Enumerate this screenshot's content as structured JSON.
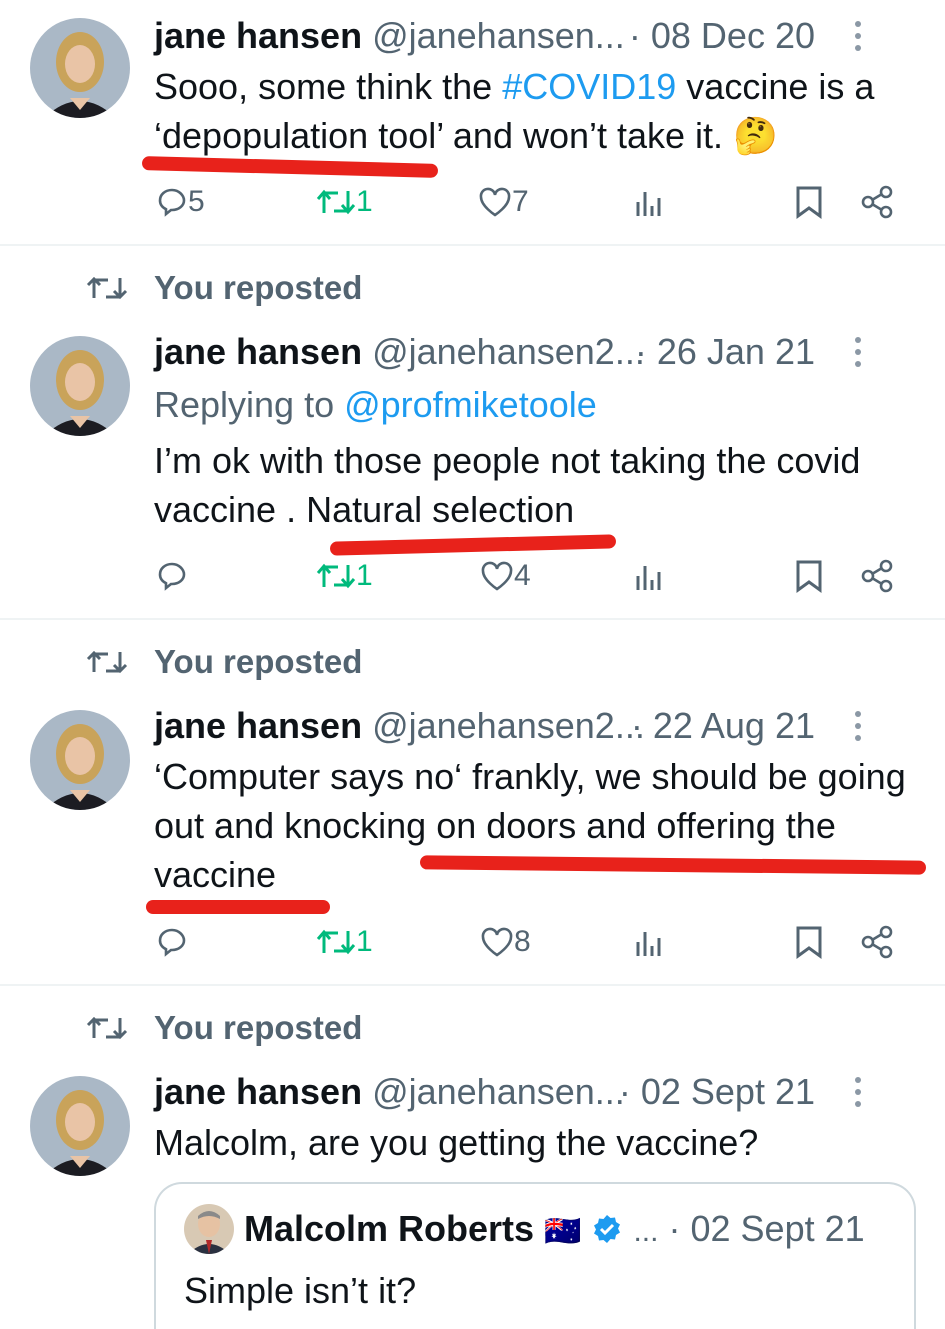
{
  "tweets": [
    {
      "reposted": false,
      "name": "jane hansen",
      "handle": "@janehansen...",
      "date": "· 08 Dec 20",
      "text_pre": "Sooo, some think the ",
      "hashtag": "#COVID19",
      "text_post": " vaccine is a ‘depopulation tool’ and won’t take it. 🤔",
      "replies": "5",
      "reposts": "1",
      "likes": "7"
    },
    {
      "reposted": true,
      "repost_label": "You reposted",
      "name": "jane hansen",
      "handle": "@janehansen2...",
      "date": "· 26 Jan 21",
      "replying_label": "Replying to ",
      "replying_to": "@profmiketoole",
      "text": "I’m ok with those people not taking the covid vaccine . Natural selection",
      "replies": "",
      "reposts": "1",
      "likes": "4"
    },
    {
      "reposted": true,
      "repost_label": "You reposted",
      "name": "jane hansen",
      "handle": "@janehansen2...",
      "date": "· 22 Aug 21",
      "text": "‘Computer says no‘  frankly, we should be going out and knocking on doors and offering the vaccine",
      "replies": "",
      "reposts": "1",
      "likes": "8"
    },
    {
      "reposted": true,
      "repost_label": "You reposted",
      "name": "jane hansen",
      "handle": "@janehansen...",
      "date": "· 02 Sept 21",
      "text": "Malcolm, are you getting the vaccine?",
      "quote": {
        "name": "Malcolm Roberts",
        "flag": "🇦🇺",
        "ellipsis": "...",
        "date": "· 02 Sept 21",
        "text": "Simple isn’t it?"
      }
    }
  ],
  "colors": {
    "accent_blue": "#1d9bf0",
    "repost_green": "#00ba7c",
    "muted_gray": "#536471",
    "annotation_red": "#e8221b"
  }
}
